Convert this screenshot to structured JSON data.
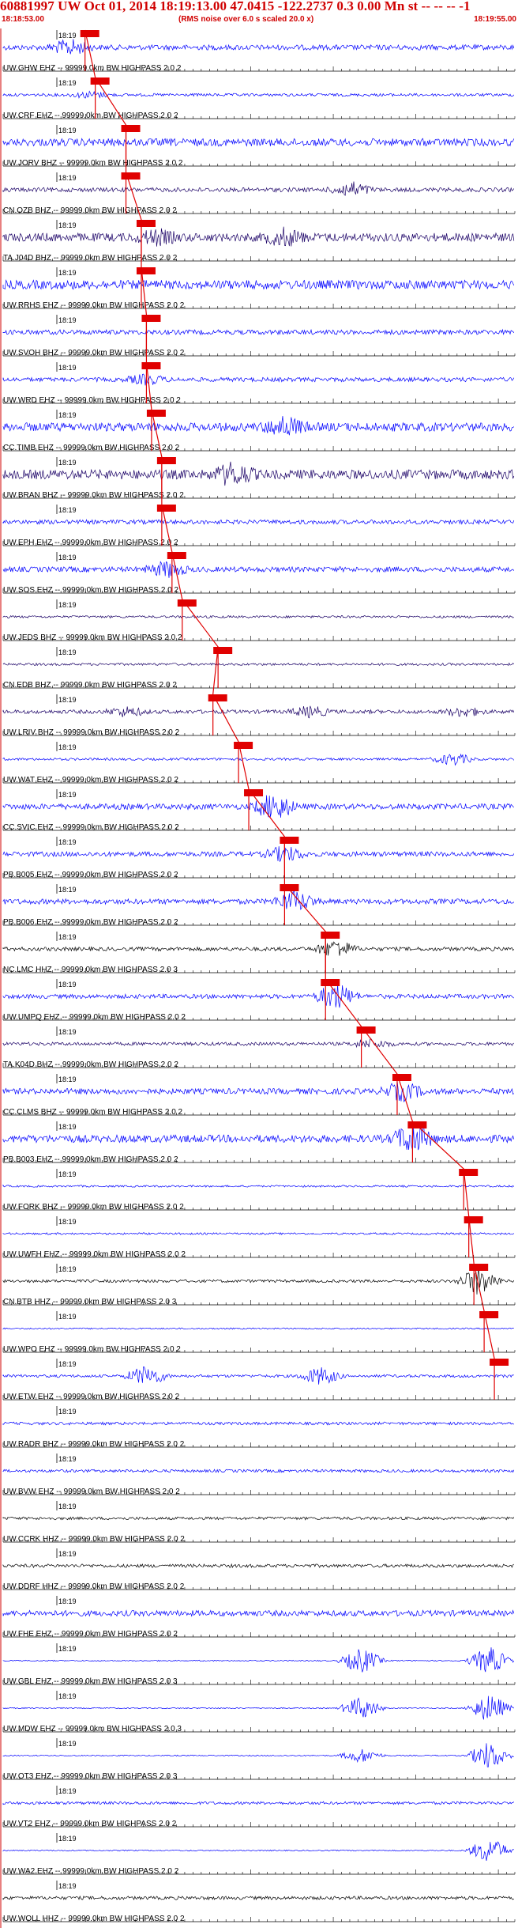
{
  "header": {
    "title": "60881997 UW Oct 01, 2014 18:19:13.00   47.0415 -122.2737  0.3 0.00 Mn st -- -- --   -1",
    "start_time": "18:18:53.00",
    "note": "(RMS noise over 6.0 s scaled 20.0 x)",
    "end_time": "18:19:55.00"
  },
  "colors": {
    "header_text": "#d00000",
    "pick": "#e00000",
    "trace_blue": "#0000ff",
    "trace_indigo": "#1a0066",
    "trace_black": "#000000"
  },
  "chart_data": {
    "type": "line",
    "title": "60881997 UW Oct 01, 2014 18:19:13.00   47.0415 -122.2737  0.3 0.00 Mn st -- -- --   -1",
    "time_range": [
      "18:18:53.00",
      "18:19:55.00"
    ],
    "minute_label": "18:19",
    "traces": [
      {
        "label": "UW.GHW EHZ -- 99999.0km BW  HIGHPASS  2.0  2",
        "color": "blue",
        "amp": 0.55,
        "bursts": [
          [
            0.13,
            0.5
          ]
        ],
        "pick": 0.16
      },
      {
        "label": "UW.CRF EHZ -- 99999.0km BW  HIGHPASS  2.0  2",
        "color": "blue",
        "amp": 0.3,
        "bursts": [
          [
            0.17,
            0.2
          ]
        ],
        "pick": 0.18
      },
      {
        "label": "UW.JORV BHZ -- 99999.0km BW  HIGHPASS  2.0  2",
        "color": "blue",
        "amp": 0.8,
        "bursts": [],
        "pick": 0.24
      },
      {
        "label": "CN.OZB BHZ -- 99999.0km BW  HIGHPASS  2.0  2",
        "color": "indigo",
        "amp": 0.45,
        "bursts": [
          [
            0.68,
            0.5
          ]
        ],
        "pick": 0.24
      },
      {
        "label": "TA.J04D BHZ -- 99999.0km BW  HIGHPASS  2.0  2",
        "color": "indigo",
        "amp": 0.9,
        "bursts": [
          [
            0.3,
            0.4
          ],
          [
            0.55,
            0.5
          ]
        ],
        "pick": 0.27
      },
      {
        "label": "UW.RRHS EHZ -- 99999.0km BW  HIGHPASS  2.0  2",
        "color": "blue",
        "amp": 0.95,
        "bursts": [],
        "pick": 0.27
      },
      {
        "label": "UW.SVOH BHZ -- 99999.0km BW  HIGHPASS  2.0  2",
        "color": "blue",
        "amp": 0.5,
        "bursts": [],
        "pick": 0.28
      },
      {
        "label": "UW.WRD EHZ -- 99999.0km BW  HIGHPASS  2.0  2",
        "color": "blue",
        "amp": 0.45,
        "bursts": [
          [
            0.28,
            0.3
          ]
        ],
        "pick": 0.28
      },
      {
        "label": "CC.TIMB EHZ -- 99999.0km BW  HIGHPASS  2.0  2",
        "color": "blue",
        "amp": 0.9,
        "bursts": [
          [
            0.55,
            0.6
          ]
        ],
        "pick": 0.29
      },
      {
        "label": "UW.BRAN BHZ -- 99999.0km BW  HIGHPASS  2.0  2",
        "color": "indigo",
        "amp": 1.0,
        "bursts": [
          [
            0.45,
            0.7
          ]
        ],
        "pick": 0.31
      },
      {
        "label": "UW.EPH EHZ -- 99999.0km BW  HIGHPASS  2.0  2",
        "color": "blue",
        "amp": 0.45,
        "bursts": [],
        "pick": 0.31
      },
      {
        "label": "UW.SOS EHZ -- 99999.0km BW  HIGHPASS  2.0  2",
        "color": "blue",
        "amp": 0.55,
        "bursts": [
          [
            0.32,
            0.5
          ]
        ],
        "pick": 0.33
      },
      {
        "label": "UW.JEDS BHZ -- 99999.0km BW  HIGHPASS  2.0  2",
        "color": "indigo",
        "amp": 0.25,
        "bursts": [],
        "pick": 0.35
      },
      {
        "label": "CN.EDB BHZ -- 99999.0km BW  HIGHPASS  2.0  2",
        "color": "indigo",
        "amp": 0.25,
        "bursts": [],
        "pick": 0.42
      },
      {
        "label": "UW.LRIV BHZ -- 99999.0km BW  HIGHPASS  2.0  2",
        "color": "indigo",
        "amp": 0.4,
        "bursts": [
          [
            0.24,
            0.3
          ],
          [
            0.6,
            0.35
          ],
          [
            0.9,
            0.3
          ]
        ],
        "pick": 0.41
      },
      {
        "label": "UW.WAT EHZ -- 99999.0km BW  HIGHPASS  2.0  2",
        "color": "blue",
        "amp": 0.25,
        "bursts": [
          [
            0.88,
            0.4
          ]
        ],
        "pick": 0.46
      },
      {
        "label": "CC.SVIC EHZ -- 99999.0km BW  HIGHPASS  2.0  2",
        "color": "blue",
        "amp": 0.6,
        "bursts": [
          [
            0.53,
            0.9
          ]
        ],
        "pick": 0.48
      },
      {
        "label": "PB.B005 EHZ -- 99999.0km BW  HIGHPASS  2.0  2",
        "color": "blue",
        "amp": 0.5,
        "bursts": [
          [
            0.55,
            0.5
          ]
        ],
        "pick": 0.55
      },
      {
        "label": "PB.B006 EHZ -- 99999.0km BW  HIGHPASS  2.0  2",
        "color": "blue",
        "amp": 0.55,
        "bursts": [
          [
            0.57,
            0.7
          ]
        ],
        "pick": 0.55
      },
      {
        "label": "NC.LMC HHZ -- 99999.0km BW  HIGHPASS  2.0  3",
        "color": "black",
        "amp": 0.4,
        "bursts": [
          [
            0.65,
            0.6
          ]
        ],
        "pick": 0.63
      },
      {
        "label": "UW.UMPQ EHZ -- 99999.0km BW  HIGHPASS  2.0  2",
        "color": "blue",
        "amp": 0.45,
        "bursts": [
          [
            0.65,
            0.9
          ]
        ],
        "pick": 0.63
      },
      {
        "label": "TA.K04D BHZ -- 99999.0km BW  HIGHPASS  2.0  2",
        "color": "indigo",
        "amp": 0.35,
        "bursts": [
          [
            0.72,
            0.3
          ]
        ],
        "pick": 0.7
      },
      {
        "label": "CC.CLMS BHZ -- 99999.0km BW  HIGHPASS  2.0  2",
        "color": "blue",
        "amp": 0.6,
        "bursts": [
          [
            0.78,
            0.6
          ]
        ],
        "pick": 0.77
      },
      {
        "label": "PB.B003 EHZ -- 99999.0km BW  HIGHPASS  2.0  2",
        "color": "blue",
        "amp": 0.8,
        "bursts": [
          [
            0.8,
            1.0
          ]
        ],
        "pick": 0.8
      },
      {
        "label": "UW.FORK BHZ -- 99999.0km BW  HIGHPASS  2.0  2",
        "color": "blue",
        "amp": 0.2,
        "bursts": [],
        "pick": 0.9
      },
      {
        "label": "UW.UWFH EHZ -- 99999.0km BW  HIGHPASS  2.0  2",
        "color": "blue",
        "amp": 0.2,
        "bursts": [],
        "pick": 0.91
      },
      {
        "label": "CN.BTB HHZ -- 99999.0km BW  HIGHPASS  2.0  3",
        "color": "black",
        "amp": 0.3,
        "bursts": [
          [
            0.93,
            1.0
          ]
        ],
        "pick": 0.92
      },
      {
        "label": "UW.WPO EHZ -- 99999.0km BW  HIGHPASS  2.0  2",
        "color": "blue",
        "amp": 0.15,
        "bursts": [],
        "pick": 0.94
      },
      {
        "label": "UW.ETW EHZ -- 99999.0km BW  HIGHPASS  2.0  2",
        "color": "blue",
        "amp": 0.3,
        "bursts": [
          [
            0.28,
            0.7
          ],
          [
            0.62,
            0.6
          ]
        ],
        "pick": 0.96
      },
      {
        "label": "UW.RADR BHZ -- 99999.0km BW  HIGHPASS  2.0  2",
        "color": "blue",
        "amp": 0.3,
        "bursts": [],
        "pick": null
      },
      {
        "label": "UW.BVW EHZ -- 99999.0km BW  HIGHPASS  2.0  2",
        "color": "blue",
        "amp": 0.3,
        "bursts": [],
        "pick": null
      },
      {
        "label": "UW.CCRK HHZ -- 99999.0km BW  HIGHPASS  2.0  2",
        "color": "black",
        "amp": 0.3,
        "bursts": [],
        "pick": null
      },
      {
        "label": "UW.DDRF HHZ -- 99999.0km BW  HIGHPASS  2.0  2",
        "color": "black",
        "amp": 0.35,
        "bursts": [],
        "pick": null
      },
      {
        "label": "UW.FHE EHZ -- 99999.0km BW  HIGHPASS  2.0  2",
        "color": "blue",
        "amp": 0.6,
        "bursts": [],
        "pick": null
      },
      {
        "label": "UW.GBL EHZ -- 99999.0km BW  HIGHPASS  2.0  3",
        "color": "blue",
        "amp": 0.12,
        "bursts": [
          [
            0.7,
            0.9
          ],
          [
            0.95,
            1.0
          ]
        ],
        "pick": null
      },
      {
        "label": "UW.MDW EHZ -- 99999.0km BW  HIGHPASS  2.0  3",
        "color": "blue",
        "amp": 0.12,
        "bursts": [
          [
            0.7,
            0.8
          ],
          [
            0.95,
            1.0
          ]
        ],
        "pick": null
      },
      {
        "label": "UW.OT3 EHZ -- 99999.0km BW  HIGHPASS  2.0  3",
        "color": "blue",
        "amp": 0.12,
        "bursts": [
          [
            0.7,
            0.5
          ],
          [
            0.95,
            1.0
          ]
        ],
        "pick": null
      },
      {
        "label": "UW.VT2 EHZ -- 99999.0km BW  HIGHPASS  2.0  2",
        "color": "blue",
        "amp": 0.3,
        "bursts": [],
        "pick": null
      },
      {
        "label": "UW.WA2 EHZ -- 99999.0km BW  HIGHPASS  2.0  2",
        "color": "blue",
        "amp": 0.12,
        "bursts": [
          [
            0.95,
            0.9
          ]
        ],
        "pick": null
      },
      {
        "label": "UW.WOLL HHZ -- 99999.0km BW  HIGHPASS  2.0  2",
        "color": "black",
        "amp": 0.35,
        "bursts": [],
        "pick": null
      }
    ]
  }
}
